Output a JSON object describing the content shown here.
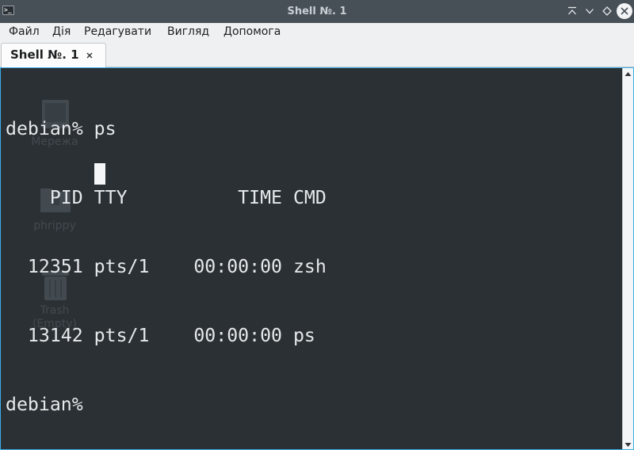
{
  "window": {
    "title": "Shell №. 1",
    "icon": "terminal-icon"
  },
  "menu": {
    "items": [
      {
        "label": "Файл"
      },
      {
        "label": "Дія"
      },
      {
        "label": "Редагувати"
      },
      {
        "label": "Вигляд"
      },
      {
        "label": "Допомога"
      }
    ]
  },
  "tabs": [
    {
      "label": "Shell №. 1",
      "close_icon": "close-icon"
    }
  ],
  "terminal": {
    "lines": [
      "debian% ps",
      "    PID TTY          TIME CMD",
      "  12351 pts/1    00:00:00 zsh",
      "  13142 pts/1    00:00:00 ps",
      "debian% "
    ]
  },
  "desktop_background": {
    "items": [
      {
        "label": "Мережа",
        "icon": "network-icon"
      },
      {
        "label": "phrippy",
        "icon": "home-folder-icon"
      },
      {
        "label": "Trash",
        "sublabel": "(Empty)",
        "icon": "trash-icon"
      }
    ]
  },
  "colors": {
    "titlebar": "#475057",
    "terminal_bg": "#2b3034",
    "terminal_fg": "#e6e9eb",
    "focus_border": "#3daee9",
    "menubar": "#eff0f1"
  }
}
